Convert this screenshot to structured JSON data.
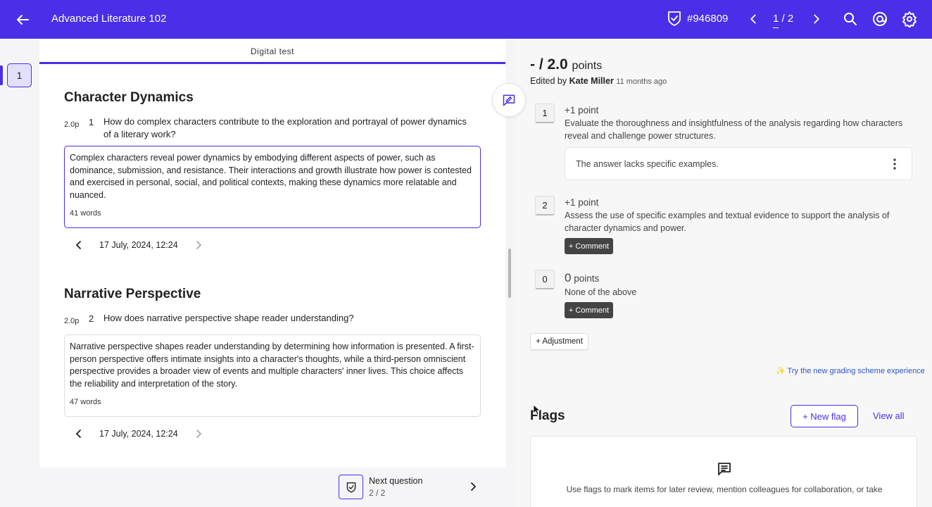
{
  "header": {
    "title": "Advanced Literature 102",
    "submission_id": "#946809",
    "pager_current": "1",
    "pager_total": "/ 2",
    "accent_color": "#4a2ee8"
  },
  "rail": {
    "question_number": "1"
  },
  "center": {
    "tab_label": "Digital test",
    "questions": [
      {
        "section_title": "Character Dynamics",
        "points": "2.0p",
        "number": "1",
        "text": "How do complex characters contribute to the exploration and portrayal of power dynamics of a literary work?",
        "answer": "Complex characters reveal power dynamics by embodying different aspects of power, such as dominance, submission, and resistance. Their interactions and growth illustrate how power is contested and exercised in personal, social, and political contexts, making these dynamics more relatable and nuanced.",
        "word_count": "41 words",
        "date": "17 July, 2024, 12:24"
      },
      {
        "section_title": "Narrative Perspective",
        "points": "2.0p",
        "number": "2",
        "text": "How does narrative perspective shape reader understanding?",
        "answer": "Narrative perspective shapes reader understanding by determining how information is presented. A first-person perspective offers intimate insights into a character's thoughts, while a third-person omniscient perspective provides a broader view of events and multiple characters' inner lives. This choice affects the reliability and interpretation of the story.",
        "word_count": "47 words",
        "date": "17 July, 2024, 12:24"
      }
    ],
    "next_question": {
      "label": "Next question",
      "count": "2 / 2"
    }
  },
  "grading": {
    "score": "- / 2.0",
    "score_unit": "points",
    "edited_prefix": "Edited by",
    "editor": "Kate Miller",
    "edited_ago": "11 months ago",
    "criteria": [
      {
        "key": "1",
        "title": "+1 point",
        "description": "Evaluate the thoroughness and insightfulness of the analysis regarding how characters reveal and challenge power structures.",
        "comment": "The answer lacks specific examples."
      },
      {
        "key": "2",
        "title": "+1 point",
        "description": "Assess the use of specific examples and textual evidence to support the analysis of character dynamics and power.",
        "comment_button": "+ Comment"
      },
      {
        "key": "0",
        "title_value": "0",
        "title_unit": "points",
        "description": "None of the above",
        "comment_button": "+ Comment"
      }
    ],
    "adjustment_button": "+ Adjustment",
    "try_new_link": "✨ Try the new grading scheme experience"
  },
  "flags": {
    "title": "Flags",
    "new_flag_button": "+ New flag",
    "view_all": "View all",
    "empty_text": "Use flags to mark items for later review, mention colleagues for collaboration, or take"
  }
}
